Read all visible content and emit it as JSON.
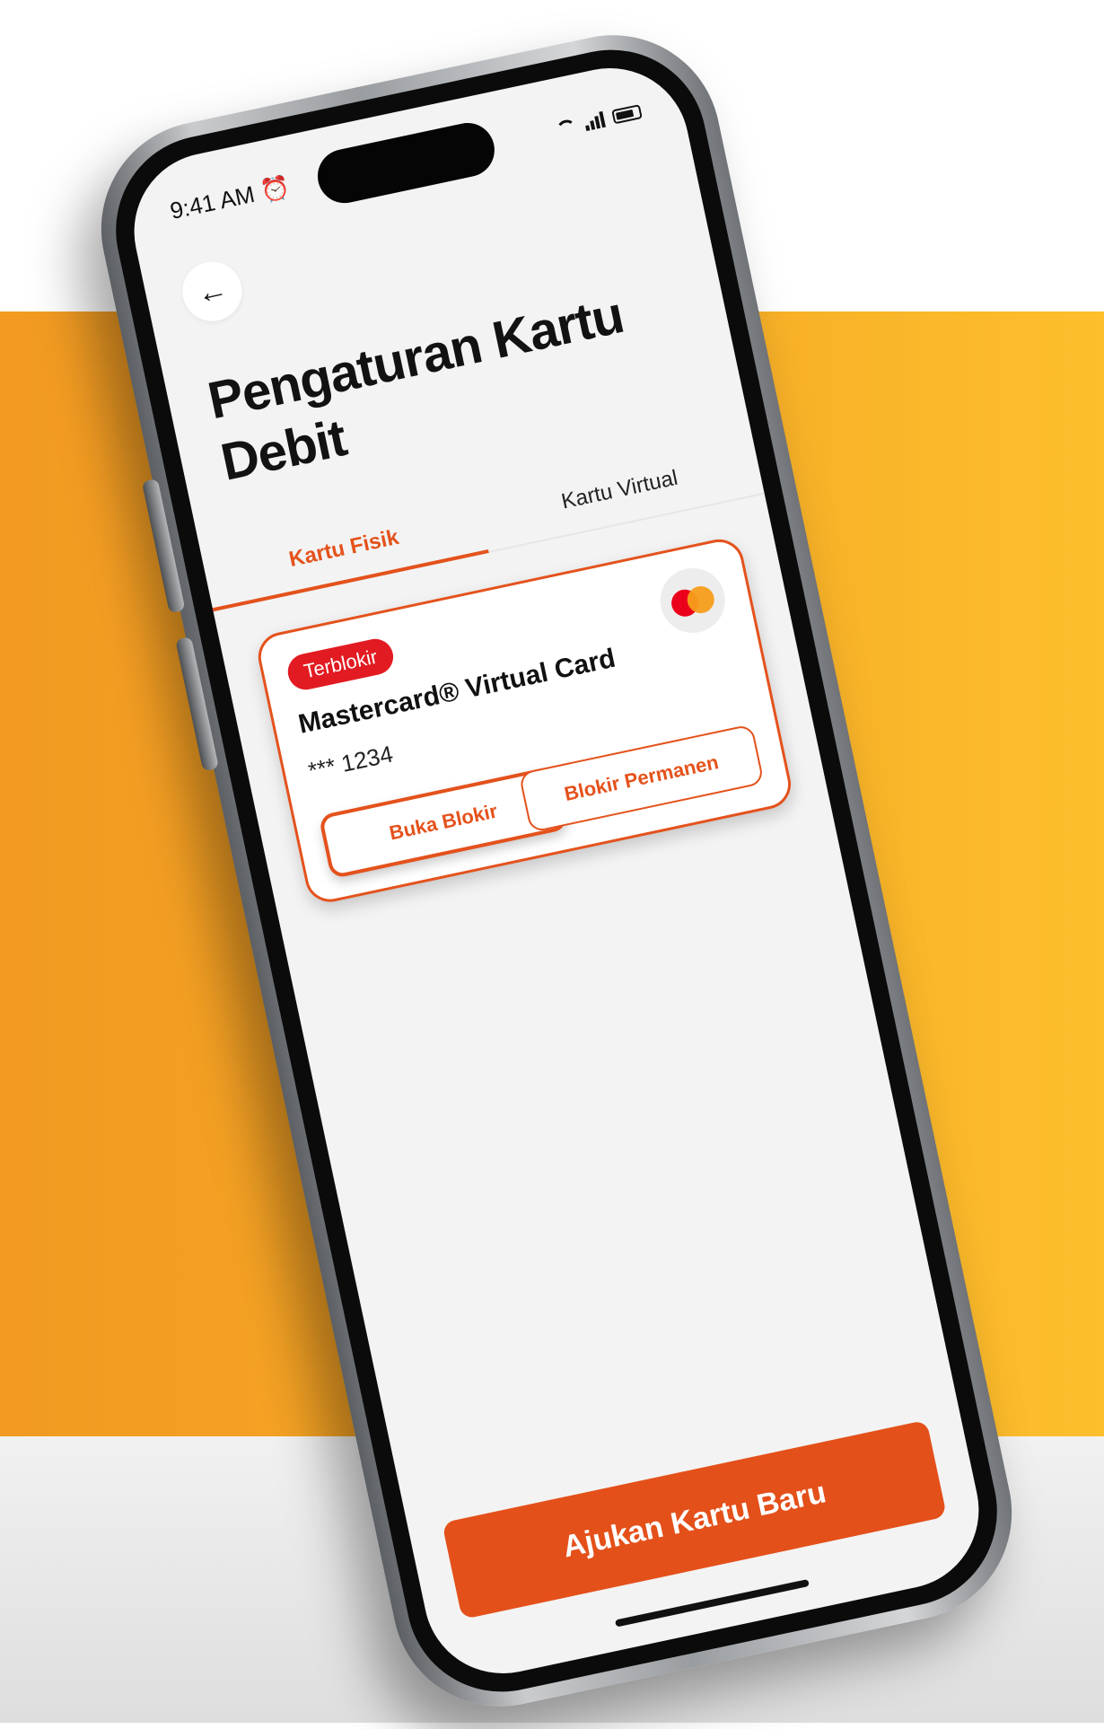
{
  "status_bar": {
    "time": "9:41 AM",
    "alarm_icon": "alarm-clock-icon",
    "wifi_icon": "wifi-icon",
    "signal_icon": "cellular-signal-icon",
    "battery_icon": "battery-icon"
  },
  "header": {
    "back_icon": "←",
    "title": "Pengaturan Kartu Debit"
  },
  "tabs": [
    {
      "label": "Kartu Fisik",
      "active": true
    },
    {
      "label": "Kartu Virtual",
      "active": false
    }
  ],
  "card": {
    "status_badge": "Terblokir",
    "name": "Mastercard® Virtual Card",
    "number": "*** 1234",
    "brand_logo": "mastercard-logo",
    "unblock_label": "Buka Blokir",
    "permanent_block_label": "Blokir Permanen"
  },
  "cta": {
    "label": "Ajukan Kartu Baru"
  },
  "colors": {
    "accent": "#e4521c",
    "badge": "#e21b22",
    "background_band": "#f6aa26"
  }
}
